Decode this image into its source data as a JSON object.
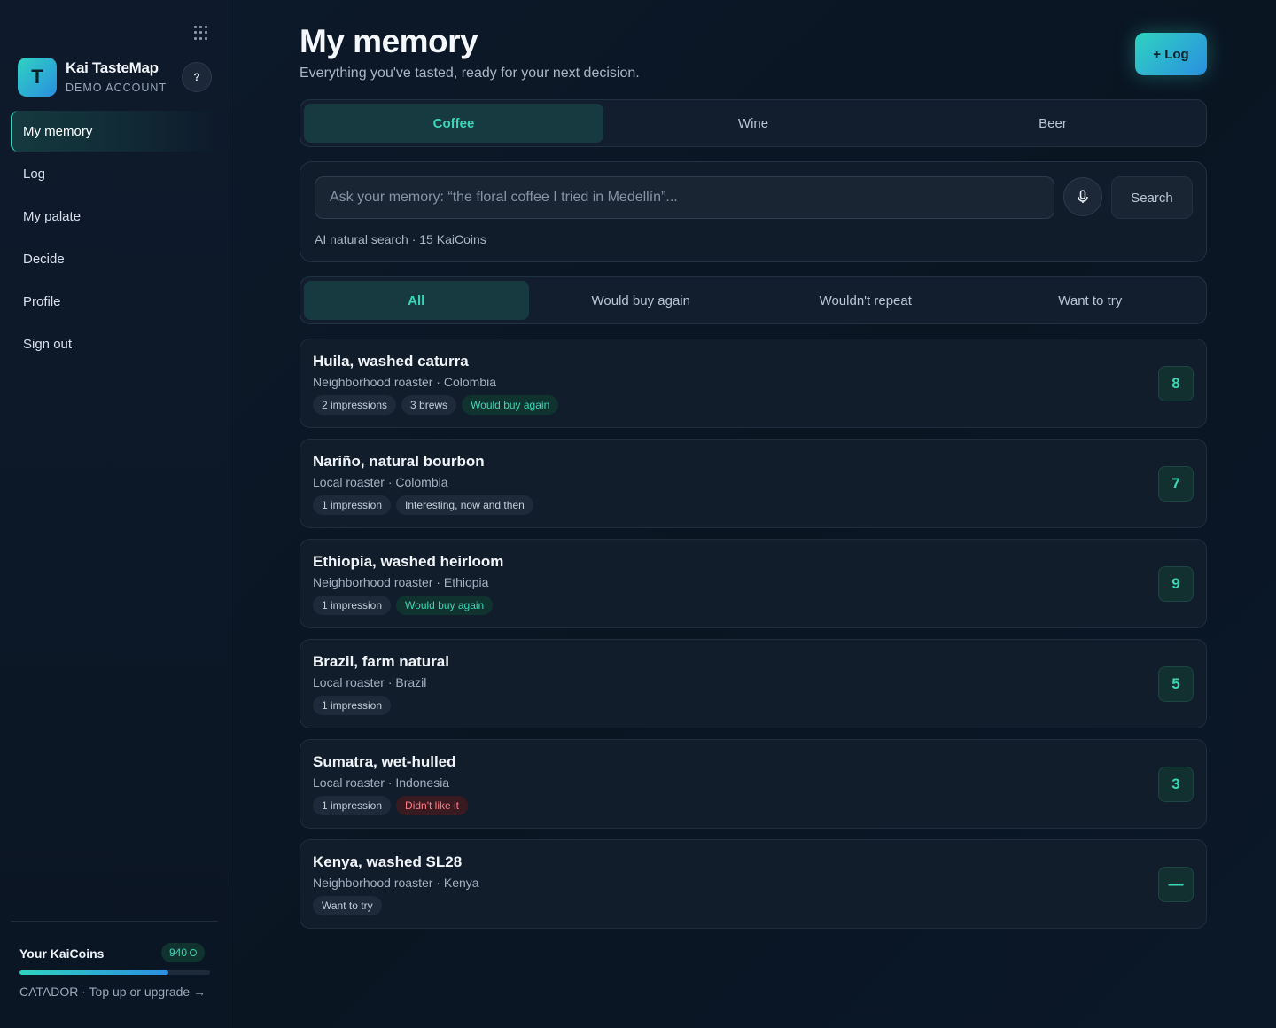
{
  "brand": {
    "logo_letter": "T",
    "name": "Kai TasteMap",
    "subtitle": "DEMO ACCOUNT",
    "help_label": "?"
  },
  "sidebar": {
    "items": [
      {
        "label": "My memory",
        "active": true
      },
      {
        "label": "Log"
      },
      {
        "label": "My palate"
      },
      {
        "label": "Decide"
      },
      {
        "label": "Profile"
      },
      {
        "label": "Sign out"
      }
    ]
  },
  "kaicoins": {
    "title": "Your KaiCoins",
    "balance": "940",
    "progress_fraction": 0.78,
    "footer": "CATADOR · Top up or upgrade →"
  },
  "header": {
    "title": "My memory",
    "subtitle": "Everything you've tasted, ready for your next decision.",
    "log_button": "+ Log"
  },
  "categories": [
    "Coffee",
    "Wine",
    "Beer"
  ],
  "search": {
    "placeholder": "Ask your memory: “the floral coffee I tried in Medellín”...",
    "value": "",
    "button": "Search",
    "note": "AI natural search · 15 KaiCoins"
  },
  "filters": [
    "All",
    "Would buy again",
    "Wouldn't repeat",
    "Want to try"
  ],
  "entries": [
    {
      "title": "Huila, washed caturra",
      "meta": "Neighborhood roaster · Colombia",
      "tags": [
        {
          "label": "2 impressions"
        },
        {
          "label": "3 brews"
        },
        {
          "label": "Would buy again",
          "tone": "good"
        }
      ],
      "score": "8"
    },
    {
      "title": "Nariño, natural bourbon",
      "meta": "Local roaster · Colombia",
      "tags": [
        {
          "label": "1 impression"
        },
        {
          "label": "Interesting, now and then"
        }
      ],
      "score": "7"
    },
    {
      "title": "Ethiopia, washed heirloom",
      "meta": "Neighborhood roaster · Ethiopia",
      "tags": [
        {
          "label": "1 impression"
        },
        {
          "label": "Would buy again",
          "tone": "good"
        }
      ],
      "score": "9"
    },
    {
      "title": "Brazil, farm natural",
      "meta": "Local roaster · Brazil",
      "tags": [
        {
          "label": "1 impression"
        }
      ],
      "score": "5"
    },
    {
      "title": "Sumatra, wet-hulled",
      "meta": "Local roaster · Indonesia",
      "tags": [
        {
          "label": "1 impression"
        },
        {
          "label": "Didn't like it",
          "tone": "bad"
        }
      ],
      "score": "3"
    },
    {
      "title": "Kenya, washed SL28",
      "meta": "Neighborhood roaster · Kenya",
      "tags": [
        {
          "label": "Want to try"
        }
      ],
      "score": "—"
    }
  ],
  "colors": {
    "accent": "#3cd6b7",
    "accent_gradient_start": "#2fd3c1",
    "accent_gradient_end": "#2a8fe0",
    "negative": "#ff7b86"
  },
  "icons": {
    "apps": "grid-icon",
    "voice": "microphone-icon",
    "coin": "coin-icon"
  }
}
